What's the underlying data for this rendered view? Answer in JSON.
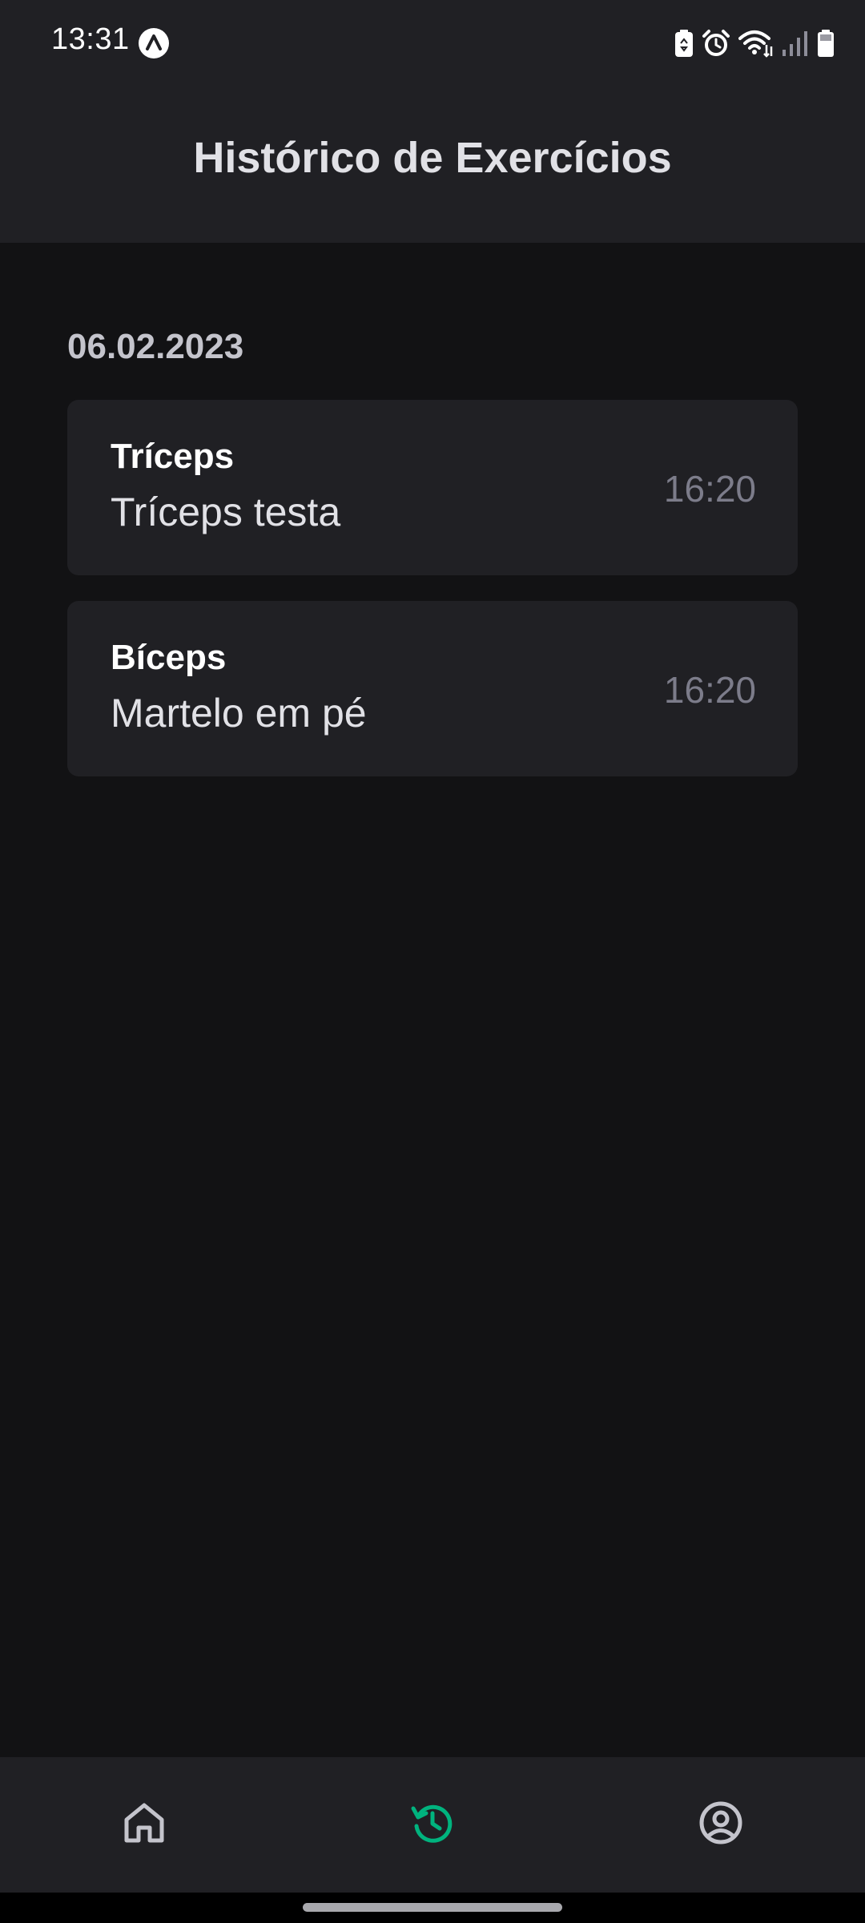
{
  "status_bar": {
    "time": "13:31",
    "icons": [
      "app-notification-icon",
      "battery-saver-icon",
      "alarm-icon",
      "wifi-icon",
      "signal-icon",
      "battery-icon"
    ]
  },
  "header": {
    "title": "Histórico de Exercícios"
  },
  "history": {
    "sections": [
      {
        "date": "06.02.2023",
        "items": [
          {
            "group": "Tríceps",
            "name": "Tríceps testa",
            "time": "16:20"
          },
          {
            "group": "Bíceps",
            "name": "Martelo em pé",
            "time": "16:20"
          }
        ]
      }
    ]
  },
  "tabs": [
    {
      "name": "home",
      "icon": "house-icon",
      "active": false
    },
    {
      "name": "history",
      "icon": "history-icon",
      "active": true
    },
    {
      "name": "profile",
      "icon": "user-circle-icon",
      "active": false
    }
  ],
  "colors": {
    "background": "#121214",
    "surface": "#202024",
    "accent": "#00b37e",
    "inactive_icon": "#c4c4cc",
    "muted_text": "#7c7c8a"
  }
}
